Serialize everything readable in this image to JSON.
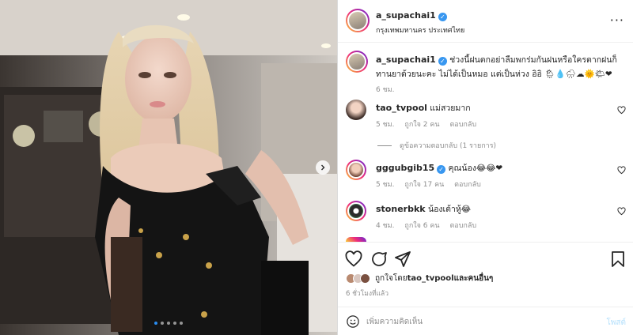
{
  "post": {
    "dots": 5,
    "active_dot": 0,
    "next_icon": "chevron-right-icon"
  },
  "header": {
    "username": "a_supachai1",
    "location": "กรุงเทพมหานคร ประเทศไทย",
    "more_icon": "ellipsis-icon",
    "more_label": "···"
  },
  "caption": {
    "username": "a_supachai1",
    "text": "ช่วงนี้ฝนตกอย่าลืมพกร่มกันฝนหรือใครตากฝนก็ทานยาด้วยนะคะ ไม่ได้เป็นหมอ แต่เป็นห่วง อิอิ",
    "emojis": "🌦💧🌧☁🌞🌤❤",
    "time": "6 ชม."
  },
  "comments": [
    {
      "username": "tao_tvpool",
      "text": "แม่สวยมาก",
      "time": "5 ชม.",
      "likes": "ถูกใจ 2 คน",
      "reply": "ตอบกลับ",
      "verified": false
    },
    {
      "username": "gggubgib15",
      "text": "คุณน้อง😂😂❤",
      "time": "5 ชม.",
      "likes": "ถูกใจ 17 คน",
      "reply": "ตอบกลับ",
      "verified": true
    },
    {
      "username": "stonerbkk",
      "text": "น้องเต้าหู้😂",
      "time": "4 ชม.",
      "likes": "ถูกใจ 6 คน",
      "reply": "ตอบกลับ",
      "verified": false
    }
  ],
  "view_replies": "ดูข้อความตอบกลับ (1 รายการ)",
  "actions": {
    "like_icon": "heart-icon",
    "comment_icon": "comment-icon",
    "share_icon": "share-icon",
    "save_icon": "bookmark-icon"
  },
  "likes_line": {
    "prefix": "ถูกใจโดย ",
    "user": "tao_tvpool",
    "suffix": " และคนอื่นๆ"
  },
  "time_ago": "6 ชั่วโมงที่แล้ว",
  "add_comment": {
    "placeholder": "เพิ่มความคิดเห็น",
    "post_label": "โพสต์",
    "emoji_icon": "smiley-icon"
  },
  "colors": {
    "accent": "#3897f0",
    "heart_red": "#ed4956",
    "muted": "#8e8e8e"
  }
}
